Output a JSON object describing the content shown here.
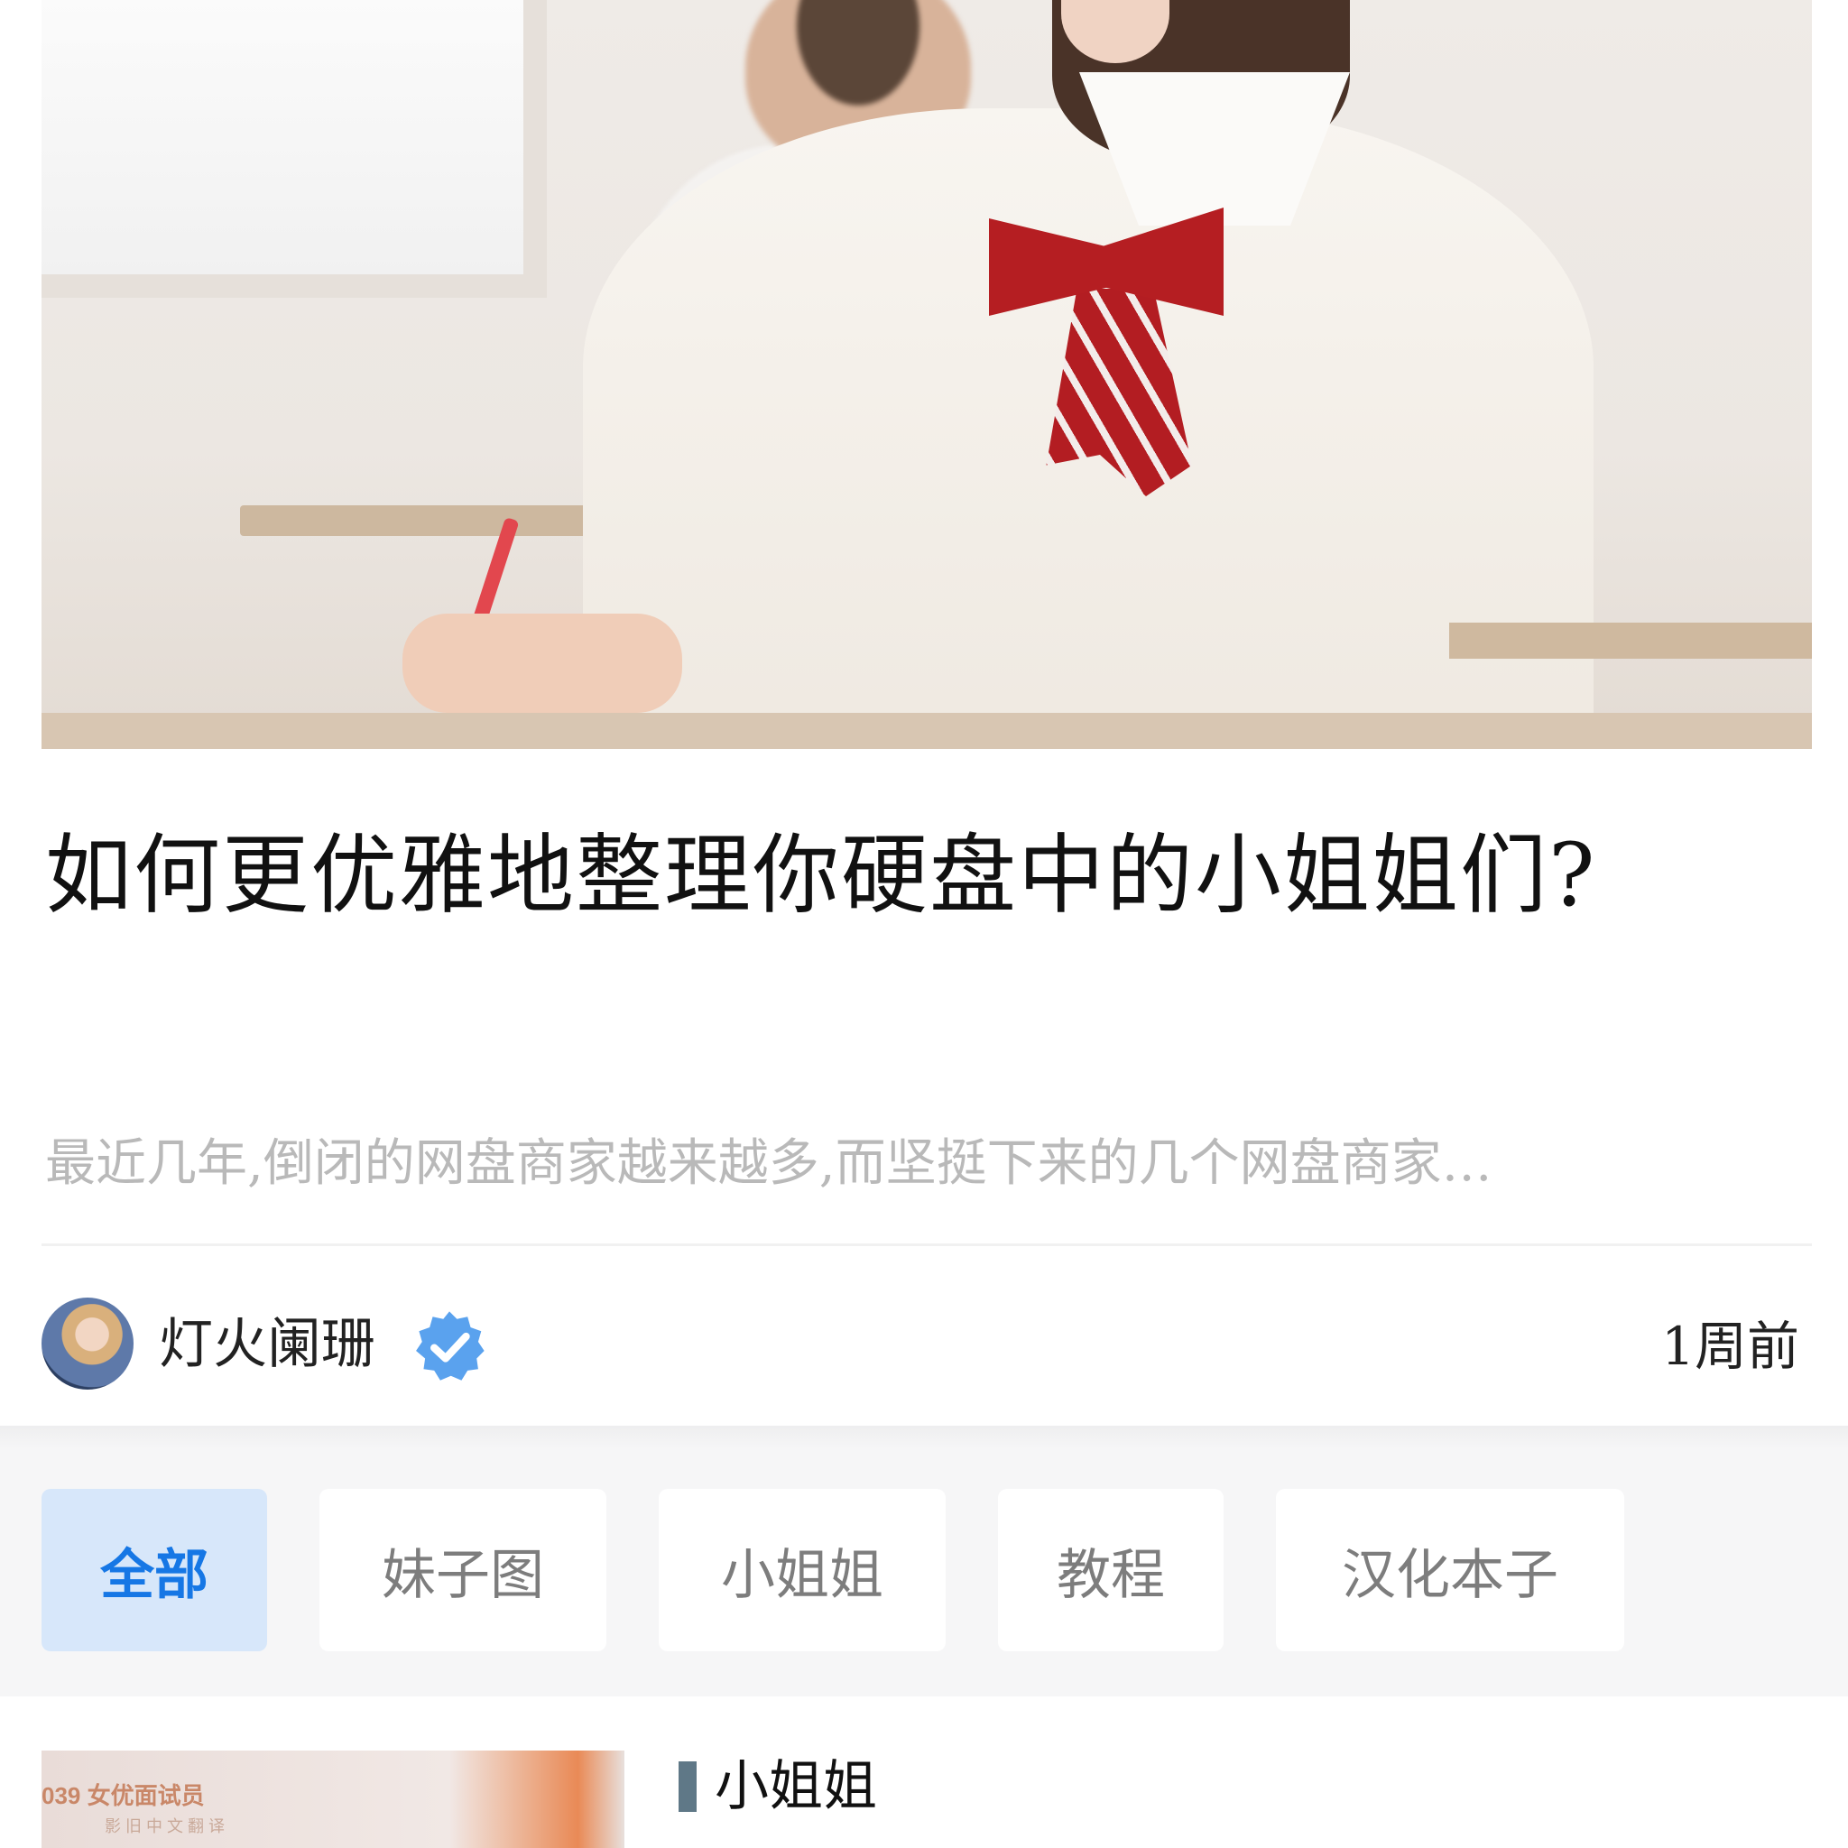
{
  "article": {
    "title": "如何更优雅地整理你硬盘中的小姐姐们?",
    "summary": "最近几年,倒闭的网盘商家越来越多,而坚挺下来的几个网盘商家…",
    "author": "灯火阑珊",
    "time": "1周前"
  },
  "categories": [
    {
      "label": "全部",
      "active": true
    },
    {
      "label": "妹子图",
      "active": false
    },
    {
      "label": "小姐姐",
      "active": false
    },
    {
      "label": "教程",
      "active": false
    },
    {
      "label": "汉化本子",
      "active": false
    }
  ],
  "next_item": {
    "category": "小姐姐",
    "thumb_text": "039 女优面试员",
    "thumb_sub": "影 旧 中 文 翻 译"
  },
  "colors": {
    "accent": "#1677e5",
    "active_tab_bg": "#d7e7fa",
    "verified": "#5aa2ee"
  },
  "icons": {
    "verified": "verified-check-icon"
  }
}
